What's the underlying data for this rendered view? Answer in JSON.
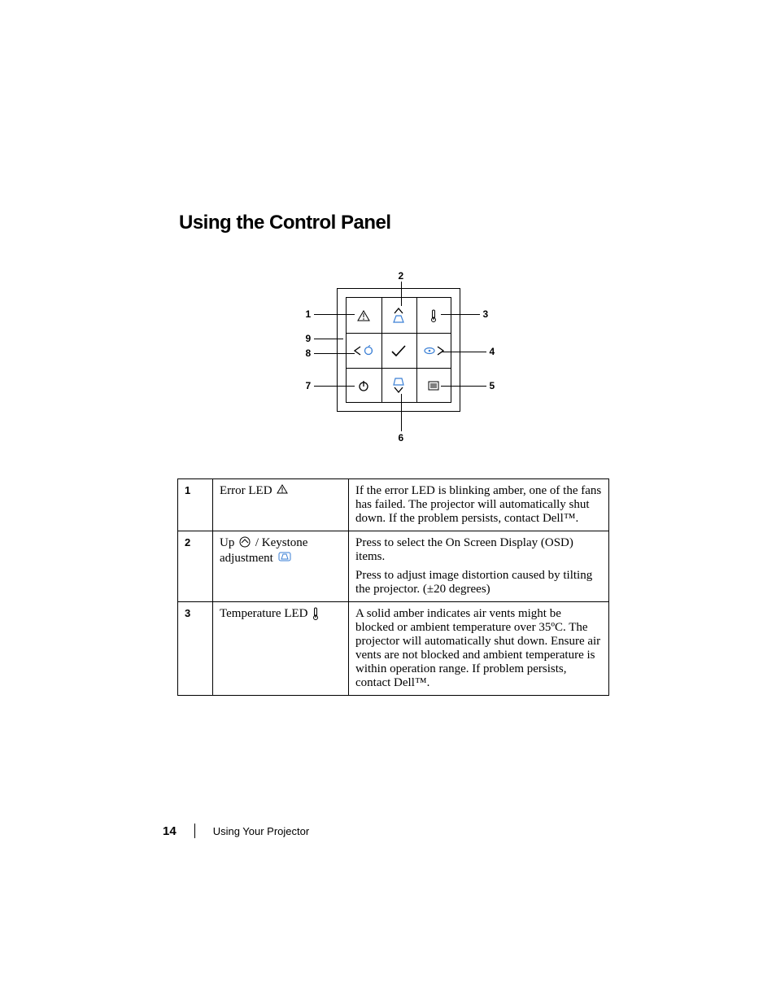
{
  "heading": "Using the Control Panel",
  "diagram": {
    "labels": {
      "1": "1",
      "2": "2",
      "3": "3",
      "4": "4",
      "5": "5",
      "6": "6",
      "7": "7",
      "8": "8",
      "9": "9"
    }
  },
  "table": {
    "rows": [
      {
        "num": "1",
        "name_pre": "Error LED ",
        "desc": [
          "If the error LED is blinking amber, one of the fans has failed. The projector will automatically shut down. If the problem persists, contact Dell™."
        ]
      },
      {
        "num": "2",
        "name_pre": "Up ",
        "name_mid": " / Keystone adjustment ",
        "desc": [
          "Press to select the On Screen Display (OSD) items.",
          "Press to adjust image distortion caused by tilting the projector. (±20 degrees)"
        ]
      },
      {
        "num": "3",
        "name_pre": "Temperature LED  ",
        "desc": [
          "A solid amber indicates air vents might be blocked or ambient temperature over 35ºC.  The projector will automatically shut down.  Ensure air vents are not blocked and ambient temperature is within operation range. If problem persists, contact Dell™."
        ]
      }
    ]
  },
  "footer": {
    "page": "14",
    "section": "Using Your Projector"
  }
}
